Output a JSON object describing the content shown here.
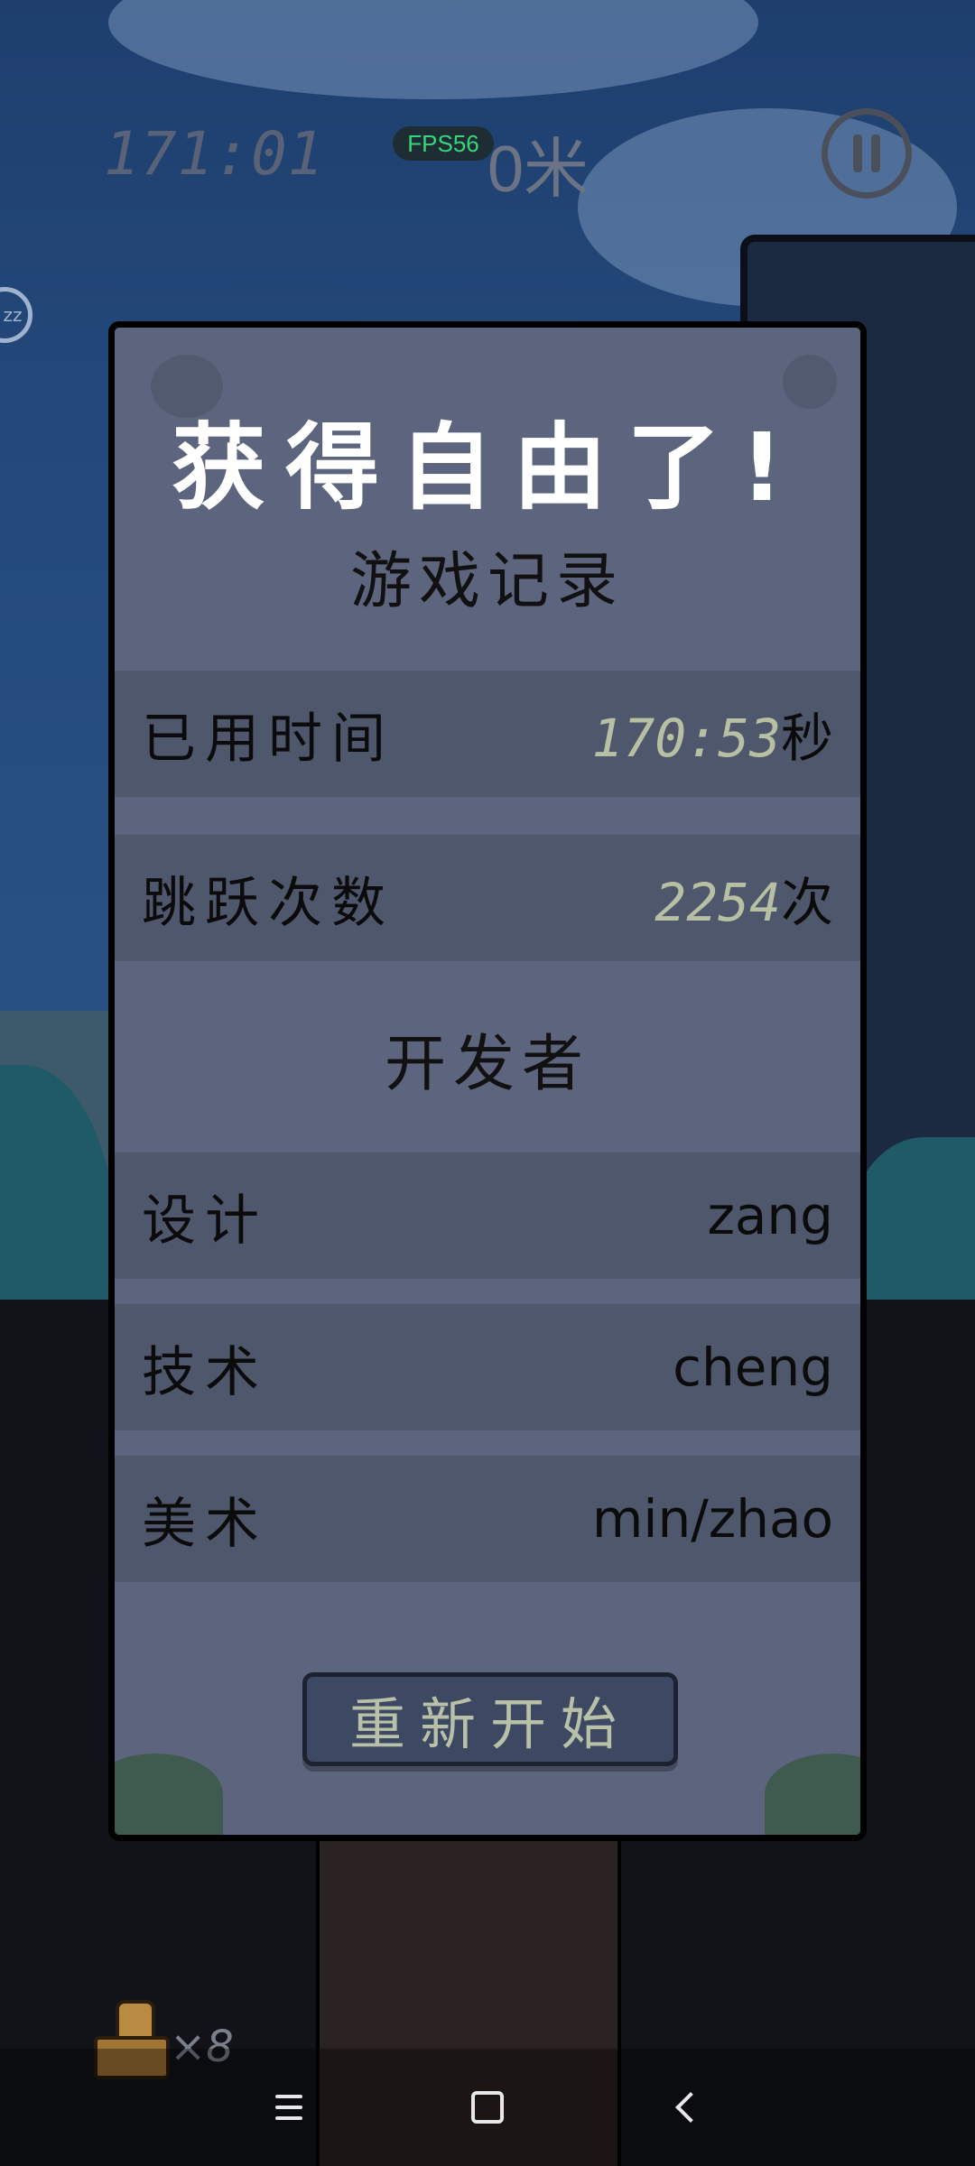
{
  "hud": {
    "timer": "171:01",
    "fps": "FPS56",
    "distance": "0米",
    "item_count": "×8",
    "zz": "zz"
  },
  "dialog": {
    "title": "获得自由了!",
    "record_heading": "游戏记录",
    "stats": [
      {
        "label": "已用时间",
        "value": "170:53",
        "unit": "秒"
      },
      {
        "label": "跳跃次数",
        "value": "2254",
        "unit": "次"
      }
    ],
    "developers_heading": "开发者",
    "credits": [
      {
        "label": "设计",
        "value": "zang"
      },
      {
        "label": "技术",
        "value": "cheng"
      },
      {
        "label": "美术",
        "value": "min/zhao"
      }
    ],
    "restart_label": "重新开始"
  },
  "icons": {
    "pause": "pause-icon",
    "item": "treasure-box-icon",
    "nav_menu": "menu-icon",
    "nav_home": "home-icon",
    "nav_back": "back-icon"
  }
}
